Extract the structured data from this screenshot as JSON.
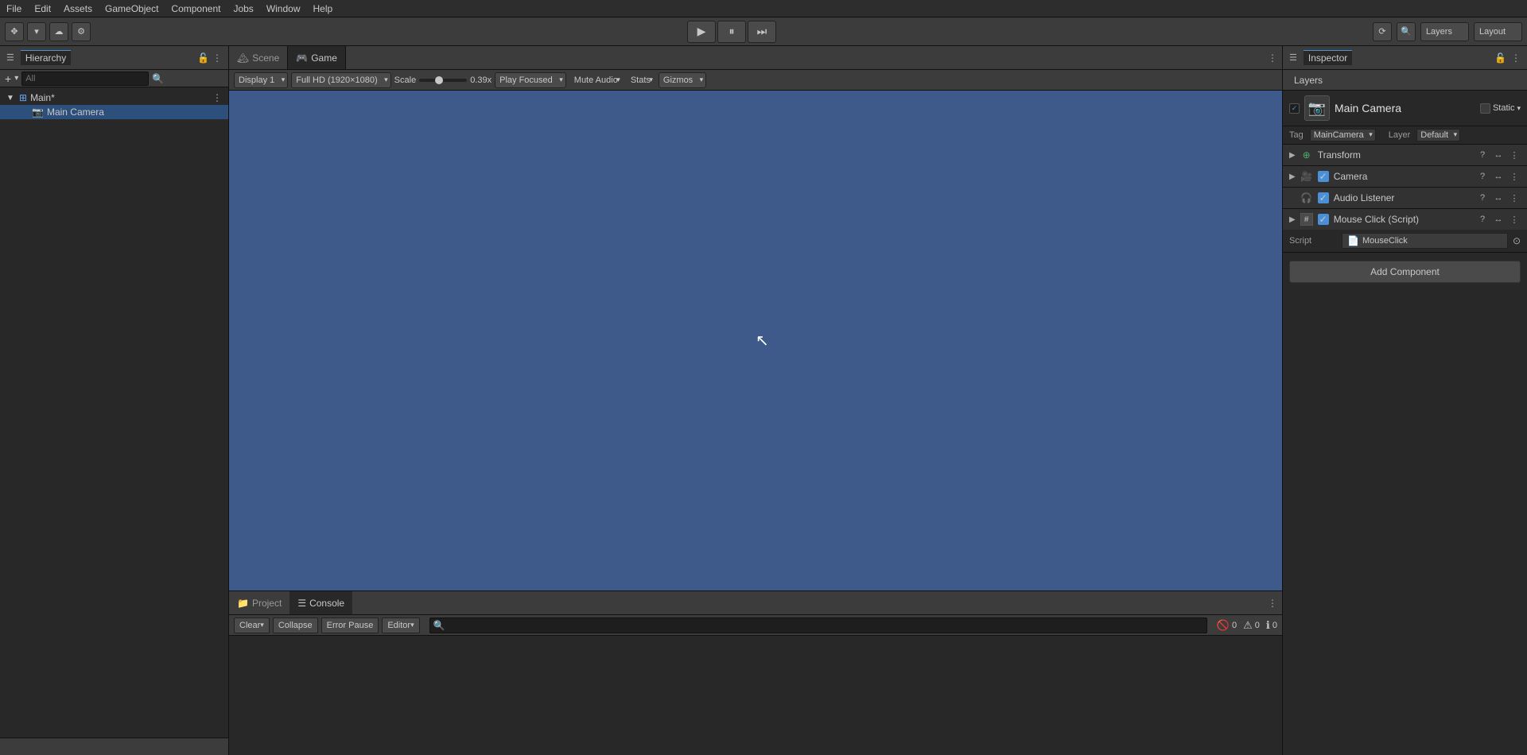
{
  "menubar": {
    "items": [
      "File",
      "Edit",
      "Assets",
      "GameObject",
      "Component",
      "Jobs",
      "Window",
      "Help"
    ]
  },
  "toolbar": {
    "layers_label": "Layers",
    "layout_label": "Layout"
  },
  "play_controls": {
    "play": "▶",
    "pause": "⏸",
    "step": "⏭"
  },
  "hierarchy": {
    "title": "Hierarchy",
    "search_placeholder": "All",
    "items": [
      {
        "name": "Main*",
        "type": "scene",
        "depth": 0,
        "expanded": true
      },
      {
        "name": "Main Camera",
        "type": "camera",
        "depth": 1
      }
    ]
  },
  "game_view": {
    "scene_tab": "Scene",
    "game_tab": "Game",
    "display_label": "Display 1",
    "resolution_label": "Full HD (1920×1080)",
    "scale_label": "Scale",
    "scale_dot": "●",
    "scale_value": "0.39x",
    "play_focused_label": "Play Focused",
    "mute_audio_label": "Mute Audio",
    "stats_label": "Stats",
    "gizmos_label": "Gizmos"
  },
  "console": {
    "project_tab": "Project",
    "console_tab": "Console",
    "clear_label": "Clear",
    "collapse_label": "Collapse",
    "error_pause_label": "Error Pause",
    "editor_label": "Editor",
    "search_placeholder": "🔍",
    "error_count": "0",
    "warning_count": "0",
    "info_count": "0"
  },
  "inspector": {
    "title": "Inspector",
    "layers_label": "Layers",
    "object_name": "Main Camera",
    "static_label": "Static",
    "tag_label": "Tag",
    "tag_value": "MainCamera",
    "layer_label": "Layer",
    "layer_value": "Default",
    "components": [
      {
        "name": "Transform",
        "icon": "⊕",
        "icon_color": "#4aaf6a",
        "checked": true,
        "type": "transform"
      },
      {
        "name": "Camera",
        "icon": "🎥",
        "checked": true,
        "type": "camera"
      },
      {
        "name": "Audio Listener",
        "icon": "🎧",
        "checked": true,
        "type": "audio"
      },
      {
        "name": "Mouse Click (Script)",
        "icon": "#",
        "checked": true,
        "type": "script",
        "script_value": "MouseClick"
      }
    ],
    "add_component_label": "Add Component"
  }
}
